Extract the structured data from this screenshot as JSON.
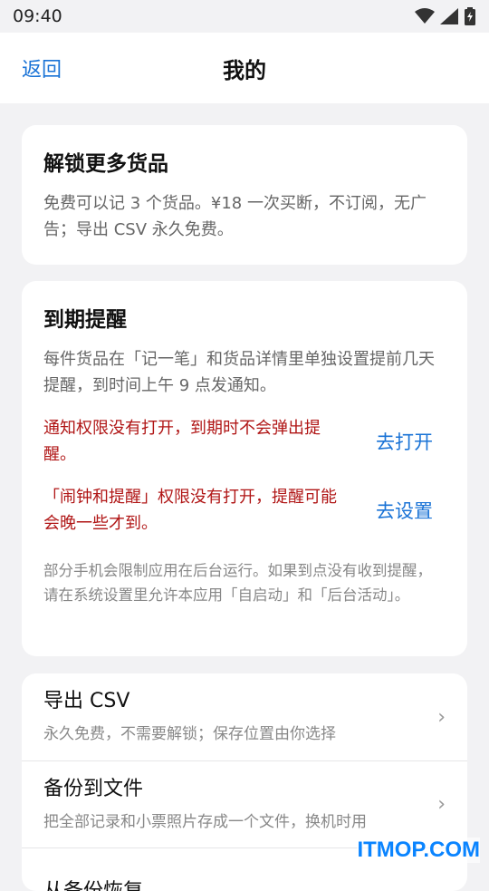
{
  "status_bar": {
    "time": "09:40",
    "icons": [
      "wifi-icon",
      "signal-icon",
      "battery-charging-icon"
    ]
  },
  "nav": {
    "back_label": "返回",
    "title": "我的"
  },
  "unlock_card": {
    "title": "解锁更多货品",
    "description": "免费可以记 3 个货品。¥18 一次买断，不订阅，无广告；导出 CSV 永久免费。"
  },
  "reminder_card": {
    "title": "到期提醒",
    "description": "每件货品在「记一笔」和货品详情里单独设置提前几天提醒，到时间上午 9 点发通知。",
    "warnings": [
      {
        "text": "通知权限没有打开，到期时不会弹出提醒。",
        "action": "去打开"
      },
      {
        "text": "「闹钟和提醒」权限没有打开，提醒可能会晚一些才到。",
        "action": "去设置"
      }
    ],
    "note": "部分手机会限制应用在后台运行。如果到点没有收到提醒，请在系统设置里允许本应用「自启动」和「后台活动」。"
  },
  "menu": {
    "items": [
      {
        "title": "导出 CSV",
        "subtitle": "永久免费，不需要解锁；保存位置由你选择"
      },
      {
        "title": "备份到文件",
        "subtitle": "把全部记录和小票照片存成一个文件，换机时用"
      },
      {
        "title": "从备份恢复",
        "subtitle": ""
      }
    ]
  },
  "watermark": "ITMOP.COM",
  "colors": {
    "accent": "#1a73d6",
    "warning": "#b01515",
    "background": "#f2f2f4"
  }
}
